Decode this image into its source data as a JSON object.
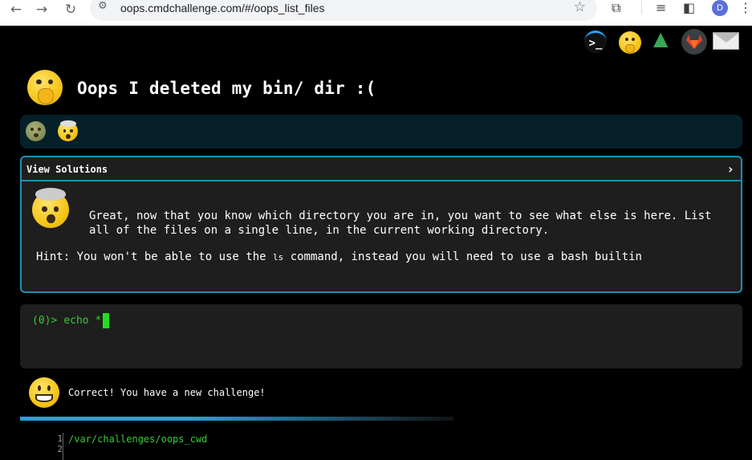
{
  "browser": {
    "url": "oops.cmdchallenge.com/#/oops_list_files",
    "profile_initial": "D"
  },
  "header": {
    "title": "Oops I deleted my bin/ dir :("
  },
  "solutions": {
    "label": "View Solutions",
    "chevron": "›",
    "description": "Great, now that you know which directory you are in, you want to see what else is here. List all of the files on a single line, in the current working directory.",
    "hint_prefix": "Hint: You won't be able to use the ",
    "hint_code": "ls",
    "hint_suffix": " command, instead you will need to use a bash builtin"
  },
  "terminal": {
    "prompt": "(0)>",
    "input": "echo *"
  },
  "result": {
    "message": "Correct! You have a new challenge!",
    "line_numbers": [
      "1",
      "2"
    ],
    "output_line": "/var/challenges/oops_cwd"
  },
  "icons": {
    "prompt_icon_text": ">_",
    "accent_color": "#1d8fb5"
  }
}
